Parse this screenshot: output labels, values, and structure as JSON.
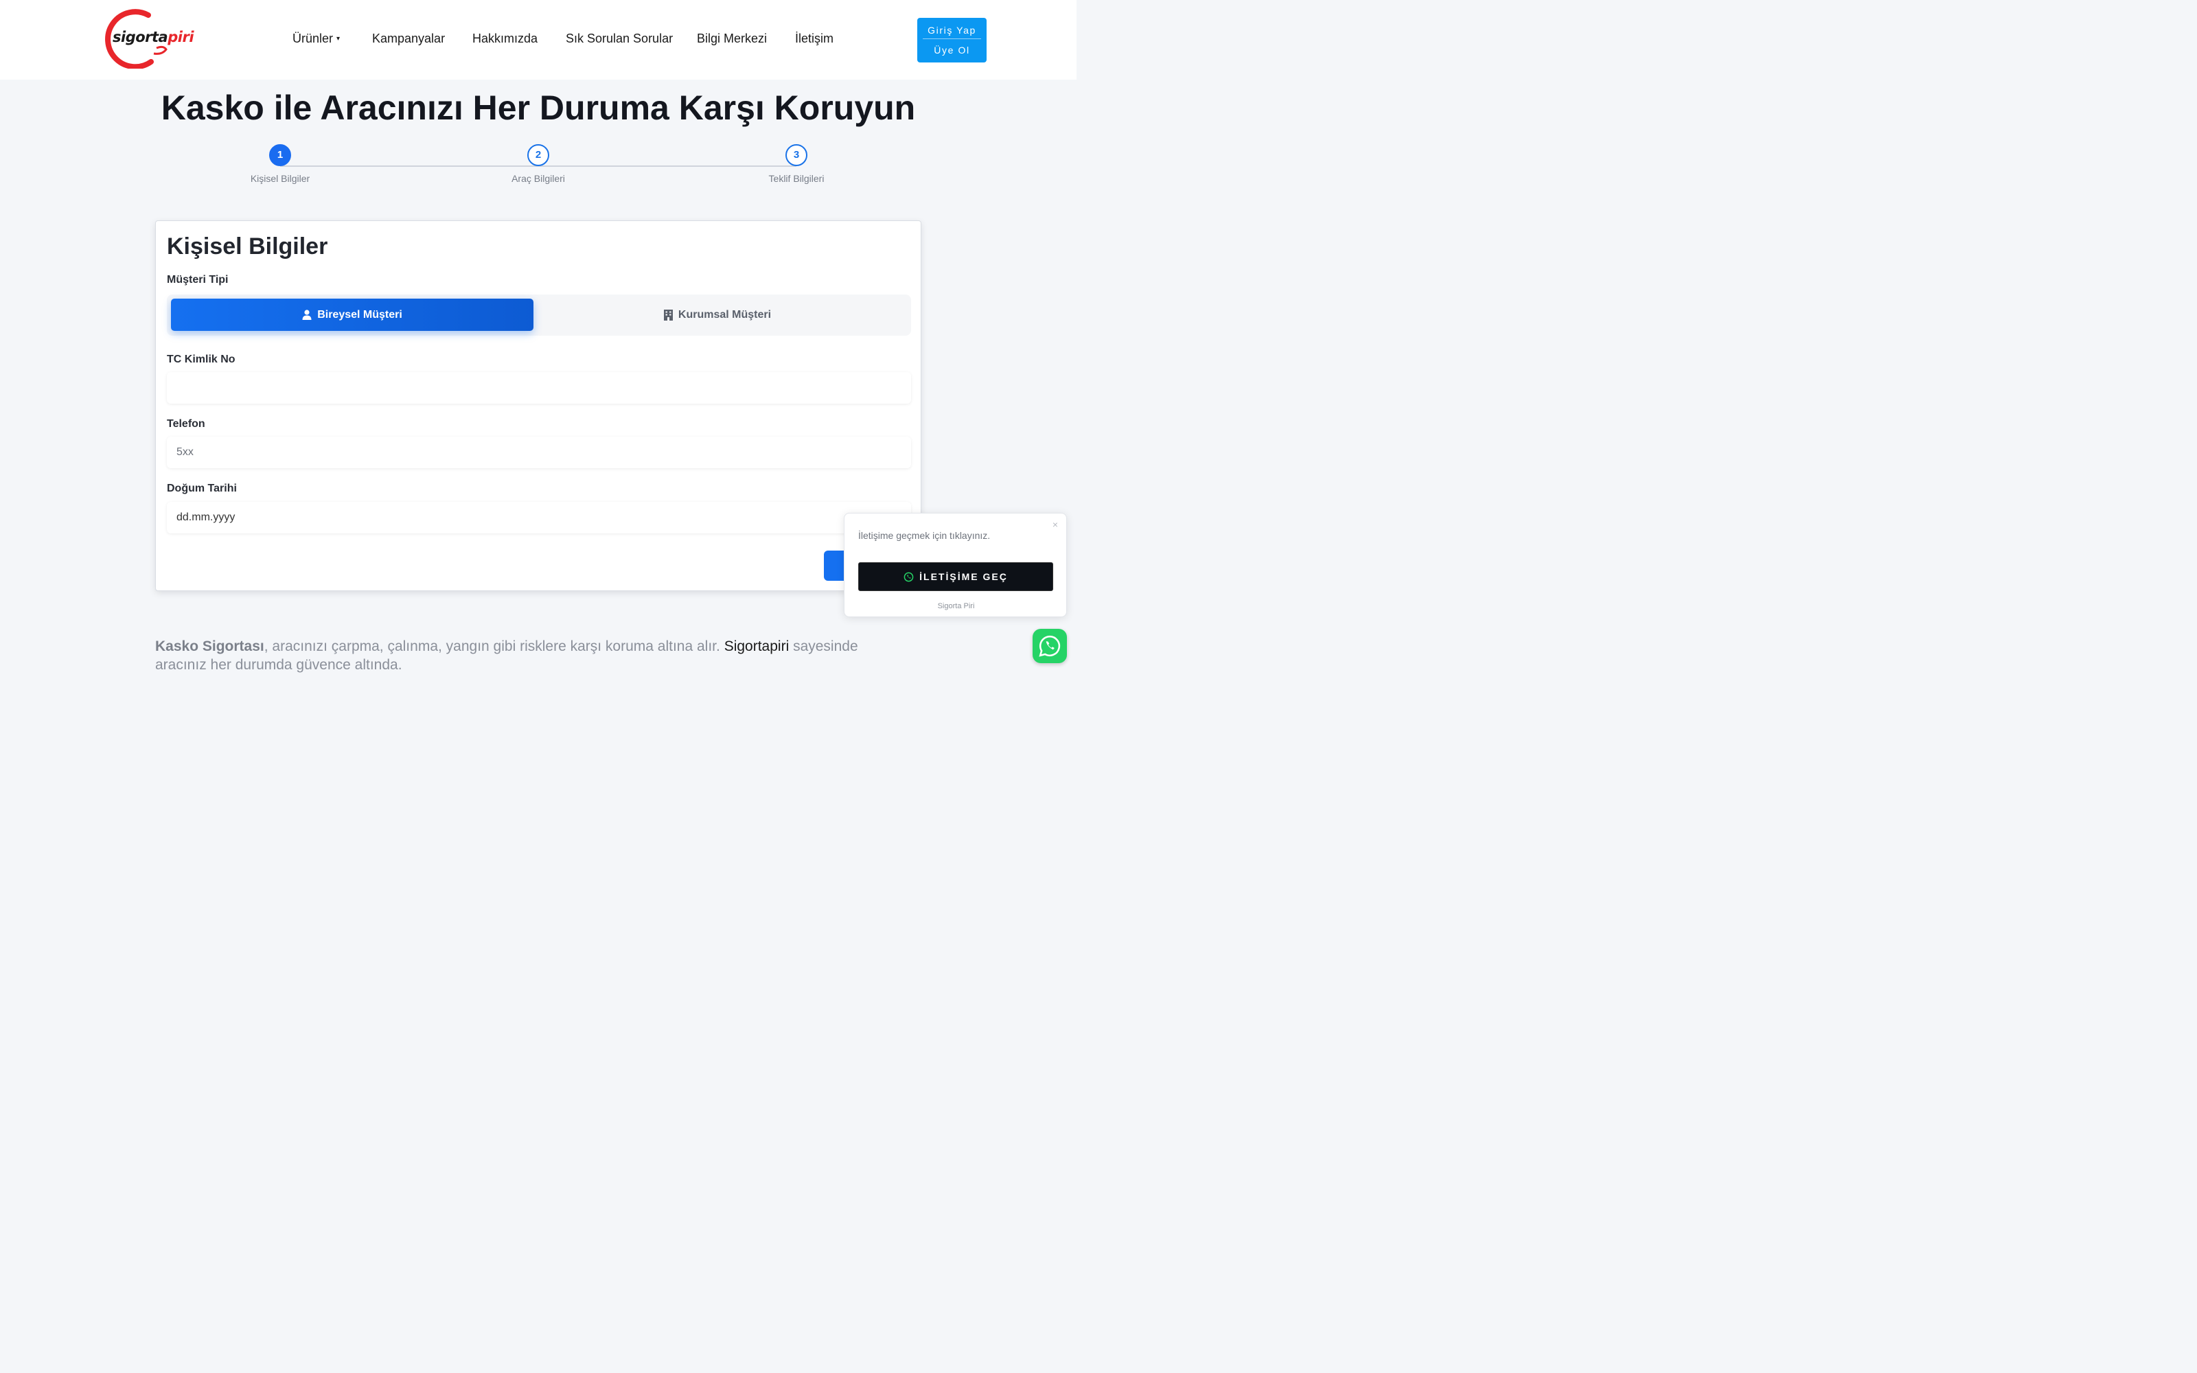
{
  "header": {
    "logo": {
      "text_main": "sigorta",
      "text_accent": "piri"
    },
    "nav": [
      {
        "label": "Ürünler",
        "has_dropdown": true
      },
      {
        "label": "Kampanyalar"
      },
      {
        "label": "Hakkımızda"
      },
      {
        "label": "Sık Sorulan Sorular"
      },
      {
        "label": "Bilgi Merkezi"
      },
      {
        "label": "İletişim"
      }
    ],
    "login_label": "Giriş Yap",
    "signup_label": "Üye Ol"
  },
  "page_title": "Kasko ile Aracınızı Her Duruma Karşı Koruyun",
  "stepper": [
    {
      "number": "1",
      "label": "Kişisel Bilgiler",
      "active": true
    },
    {
      "number": "2",
      "label": "Araç Bilgileri",
      "active": false
    },
    {
      "number": "3",
      "label": "Teklif Bilgileri",
      "active": false
    }
  ],
  "form": {
    "title": "Kişisel Bilgiler",
    "customer_type_label": "Müşteri Tipi",
    "customer_types": [
      {
        "label": "Bireysel Müşteri",
        "selected": true,
        "icon": "user-icon"
      },
      {
        "label": "Kurumsal Müşteri",
        "selected": false,
        "icon": "building-icon"
      }
    ],
    "tc_label": "TC Kimlik No",
    "tc_value": "",
    "phone_label": "Telefon",
    "phone_placeholder": "5xx",
    "birth_label": "Doğum Tarihi",
    "birth_placeholder": "dd.mm.yyyy"
  },
  "intro": {
    "strong": "Kasko Sigortası",
    "text1": ", aracınızı çarpma, çalınma, yangın gibi risklere karşı koruma altına alır. ",
    "brand": "Sigortapiri",
    "text2": " sayesinde aracınız her durumda güvence altında."
  },
  "popup": {
    "message": "İletişime geçmek için tıklayınız.",
    "button_label": "İLETİŞİME GEÇ",
    "footer": "Sigorta Piri",
    "close": "×"
  },
  "colors": {
    "primary": "#1570f0",
    "accent_red": "#e8262b",
    "login_blue": "#0b98f2",
    "whatsapp": "#25d366"
  }
}
